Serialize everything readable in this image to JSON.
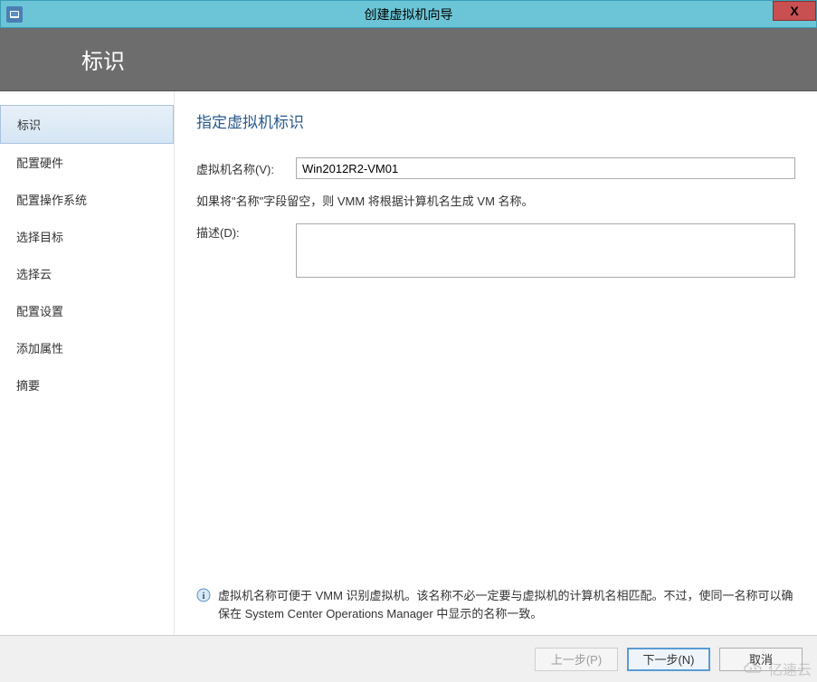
{
  "window": {
    "title": "创建虚拟机向导",
    "close_label": "X"
  },
  "header": {
    "title": "标识"
  },
  "sidebar": {
    "items": [
      {
        "label": "标识",
        "active": true
      },
      {
        "label": "配置硬件",
        "active": false
      },
      {
        "label": "配置操作系统",
        "active": false
      },
      {
        "label": "选择目标",
        "active": false
      },
      {
        "label": "选择云",
        "active": false
      },
      {
        "label": "配置设置",
        "active": false
      },
      {
        "label": "添加属性",
        "active": false
      },
      {
        "label": "摘要",
        "active": false
      }
    ]
  },
  "main": {
    "section_title": "指定虚拟机标识",
    "vm_name_label": "虚拟机名称(V):",
    "vm_name_value": "Win2012R2-VM01",
    "vm_name_help": "如果将\"名称\"字段留空，则 VMM 将根据计算机名生成 VM 名称。",
    "description_label": "描述(D):",
    "description_value": "",
    "info_text": "虚拟机名称可便于 VMM 识别虚拟机。该名称不必一定要与虚拟机的计算机名相匹配。不过，使同一名称可以确保在 System Center Operations Manager 中显示的名称一致。"
  },
  "footer": {
    "prev_label": "上一步(P)",
    "next_label": "下一步(N)",
    "cancel_label": "取消"
  },
  "watermark": {
    "text": "亿速云"
  }
}
